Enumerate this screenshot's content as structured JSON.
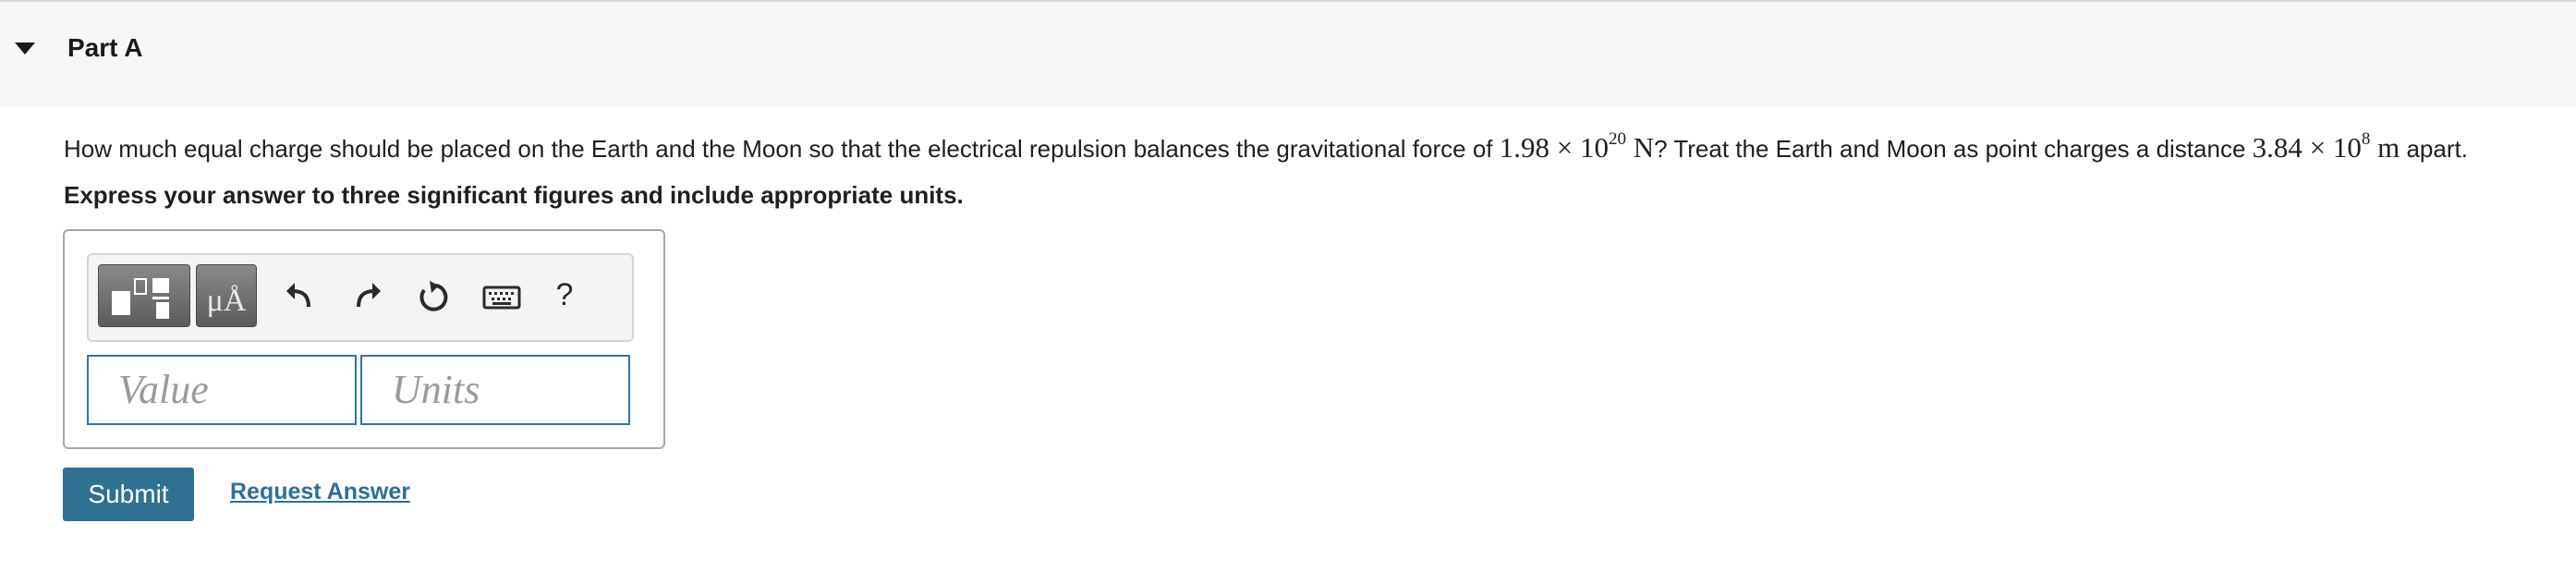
{
  "part": {
    "title": "Part A"
  },
  "question": {
    "text_before": "How much equal charge should be placed on the Earth and the Moon so that the electrical repulsion balances the gravitational force of ",
    "force_mantissa": "1.98",
    "times_1": "×",
    "force_base": "10",
    "force_exponent": "20",
    "force_unit": "N",
    "text_middle": "? Treat the Earth and Moon as point charges a distance ",
    "distance_mantissa": "3.84",
    "times_2": "×",
    "distance_base": "10",
    "distance_exponent": "8",
    "distance_unit": "m",
    "text_after": " apart."
  },
  "instruction": "Express your answer to three significant figures and include appropriate units.",
  "toolbar": {
    "units_label": "μÅ",
    "help_label": "?",
    "icons": [
      "templates-icon",
      "units-icon",
      "undo-icon",
      "redo-icon",
      "reset-icon",
      "keyboard-icon",
      "help-icon"
    ]
  },
  "inputs": {
    "value_placeholder": "Value",
    "units_placeholder": "Units"
  },
  "actions": {
    "submit_label": "Submit",
    "request_label": "Request Answer"
  },
  "colors": {
    "accent": "#2e7193",
    "link": "#2d6f97",
    "input_border": "#2f7699",
    "header_bg": "#f6f6f6"
  }
}
